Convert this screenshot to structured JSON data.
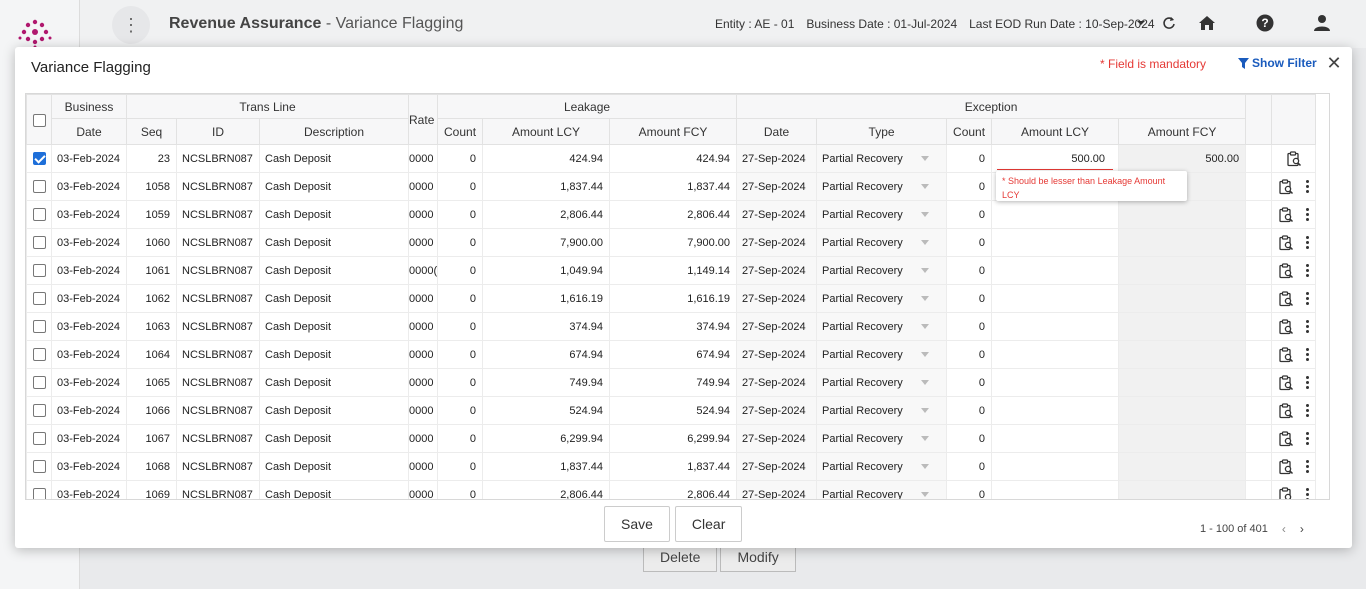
{
  "header": {
    "title_main": "Revenue Assurance",
    "title_sub": " - Variance Flagging",
    "entity": "Entity : AE - 01",
    "business_date": "Business Date : 01-Jul-2024",
    "last_eod": "Last EOD Run Date : 10-Sep-2024"
  },
  "background_actions": {
    "delete_label": "Delete",
    "modify_label": "Modify"
  },
  "modal": {
    "title": "Variance Flagging",
    "mandatory_note": "* Field is mandatory",
    "show_filter_label": "Show Filter",
    "close_label": "✕"
  },
  "table": {
    "group_headers": {
      "business": "Business",
      "trans_line": "Trans Line",
      "rate": "Rate",
      "leakage": "Leakage",
      "exception": "Exception"
    },
    "columns": {
      "date": "Date",
      "seq": "Seq",
      "id": "ID",
      "description": "Description",
      "leak_count": "Count",
      "leak_amount_lcy": "Amount LCY",
      "leak_amount_fcy": "Amount FCY",
      "exc_date": "Date",
      "exc_type": "Type",
      "exc_count": "Count",
      "exc_amount_lcy": "Amount LCY",
      "exc_amount_fcy": "Amount FCY"
    },
    "rows": [
      {
        "checked": true,
        "date": "03-Feb-2024",
        "seq": "23",
        "id": "NCSLBRN087",
        "desc": "Cash Deposit",
        "rate": "0000",
        "count": "0",
        "lcy": "424.94",
        "fcy": "424.94",
        "exc_date": "27-Sep-2024",
        "type": "Partial Recovery",
        "exc_count": "0",
        "exc_lcy": "500.00",
        "exc_fcy": "500.00"
      },
      {
        "checked": false,
        "date": "03-Feb-2024",
        "seq": "1058",
        "id": "NCSLBRN087",
        "desc": "Cash Deposit",
        "rate": "0000",
        "count": "0",
        "lcy": "1,837.44",
        "fcy": "1,837.44",
        "exc_date": "27-Sep-2024",
        "type": "Partial Recovery",
        "exc_count": "0",
        "exc_lcy": "",
        "exc_fcy": ""
      },
      {
        "checked": false,
        "date": "03-Feb-2024",
        "seq": "1059",
        "id": "NCSLBRN087",
        "desc": "Cash Deposit",
        "rate": "0000",
        "count": "0",
        "lcy": "2,806.44",
        "fcy": "2,806.44",
        "exc_date": "27-Sep-2024",
        "type": "Partial Recovery",
        "exc_count": "0",
        "exc_lcy": "",
        "exc_fcy": ""
      },
      {
        "checked": false,
        "date": "03-Feb-2024",
        "seq": "1060",
        "id": "NCSLBRN087",
        "desc": "Cash Deposit",
        "rate": "0000",
        "count": "0",
        "lcy": "7,900.00",
        "fcy": "7,900.00",
        "exc_date": "27-Sep-2024",
        "type": "Partial Recovery",
        "exc_count": "0",
        "exc_lcy": "",
        "exc_fcy": ""
      },
      {
        "checked": false,
        "date": "03-Feb-2024",
        "seq": "1061",
        "id": "NCSLBRN087",
        "desc": "Cash Deposit",
        "rate": "0000(",
        "count": "0",
        "lcy": "1,049.94",
        "fcy": "1,149.14",
        "exc_date": "27-Sep-2024",
        "type": "Partial Recovery",
        "exc_count": "0",
        "exc_lcy": "",
        "exc_fcy": ""
      },
      {
        "checked": false,
        "date": "03-Feb-2024",
        "seq": "1062",
        "id": "NCSLBRN087",
        "desc": "Cash Deposit",
        "rate": "0000",
        "count": "0",
        "lcy": "1,616.19",
        "fcy": "1,616.19",
        "exc_date": "27-Sep-2024",
        "type": "Partial Recovery",
        "exc_count": "0",
        "exc_lcy": "",
        "exc_fcy": ""
      },
      {
        "checked": false,
        "date": "03-Feb-2024",
        "seq": "1063",
        "id": "NCSLBRN087",
        "desc": "Cash Deposit",
        "rate": "0000",
        "count": "0",
        "lcy": "374.94",
        "fcy": "374.94",
        "exc_date": "27-Sep-2024",
        "type": "Partial Recovery",
        "exc_count": "0",
        "exc_lcy": "",
        "exc_fcy": ""
      },
      {
        "checked": false,
        "date": "03-Feb-2024",
        "seq": "1064",
        "id": "NCSLBRN087",
        "desc": "Cash Deposit",
        "rate": "0000",
        "count": "0",
        "lcy": "674.94",
        "fcy": "674.94",
        "exc_date": "27-Sep-2024",
        "type": "Partial Recovery",
        "exc_count": "0",
        "exc_lcy": "",
        "exc_fcy": ""
      },
      {
        "checked": false,
        "date": "03-Feb-2024",
        "seq": "1065",
        "id": "NCSLBRN087",
        "desc": "Cash Deposit",
        "rate": "0000",
        "count": "0",
        "lcy": "749.94",
        "fcy": "749.94",
        "exc_date": "27-Sep-2024",
        "type": "Partial Recovery",
        "exc_count": "0",
        "exc_lcy": "",
        "exc_fcy": ""
      },
      {
        "checked": false,
        "date": "03-Feb-2024",
        "seq": "1066",
        "id": "NCSLBRN087",
        "desc": "Cash Deposit",
        "rate": "0000",
        "count": "0",
        "lcy": "524.94",
        "fcy": "524.94",
        "exc_date": "27-Sep-2024",
        "type": "Partial Recovery",
        "exc_count": "0",
        "exc_lcy": "",
        "exc_fcy": ""
      },
      {
        "checked": false,
        "date": "03-Feb-2024",
        "seq": "1067",
        "id": "NCSLBRN087",
        "desc": "Cash Deposit",
        "rate": "0000",
        "count": "0",
        "lcy": "6,299.94",
        "fcy": "6,299.94",
        "exc_date": "27-Sep-2024",
        "type": "Partial Recovery",
        "exc_count": "0",
        "exc_lcy": "",
        "exc_fcy": ""
      },
      {
        "checked": false,
        "date": "03-Feb-2024",
        "seq": "1068",
        "id": "NCSLBRN087",
        "desc": "Cash Deposit",
        "rate": "0000",
        "count": "0",
        "lcy": "1,837.44",
        "fcy": "1,837.44",
        "exc_date": "27-Sep-2024",
        "type": "Partial Recovery",
        "exc_count": "0",
        "exc_lcy": "",
        "exc_fcy": ""
      },
      {
        "checked": false,
        "date": "03-Feb-2024",
        "seq": "1069",
        "id": "NCSLBRN087",
        "desc": "Cash Deposit",
        "rate": "0000",
        "count": "0",
        "lcy": "2,806.44",
        "fcy": "2,806.44",
        "exc_date": "27-Sep-2024",
        "type": "Partial Recovery",
        "exc_count": "0",
        "exc_lcy": "",
        "exc_fcy": ""
      }
    ]
  },
  "validation_tooltip": "* Should be lesser than Leakage Amount LCY",
  "footer": {
    "save_label": "Save",
    "clear_label": "Clear",
    "pagination": "1 - 100 of 401",
    "prev_icon": "‹",
    "next_icon": "›"
  },
  "colors": {
    "accent": "#1a5bbd",
    "error": "#e53935",
    "checkbox": "#1e6fd9"
  },
  "icons": [
    "kebab-icon",
    "chevron-down-icon",
    "refresh-icon",
    "home-icon",
    "help-icon",
    "user-icon",
    "filter-icon",
    "close-icon",
    "clipboard-search-icon",
    "more-vertical-icon"
  ]
}
